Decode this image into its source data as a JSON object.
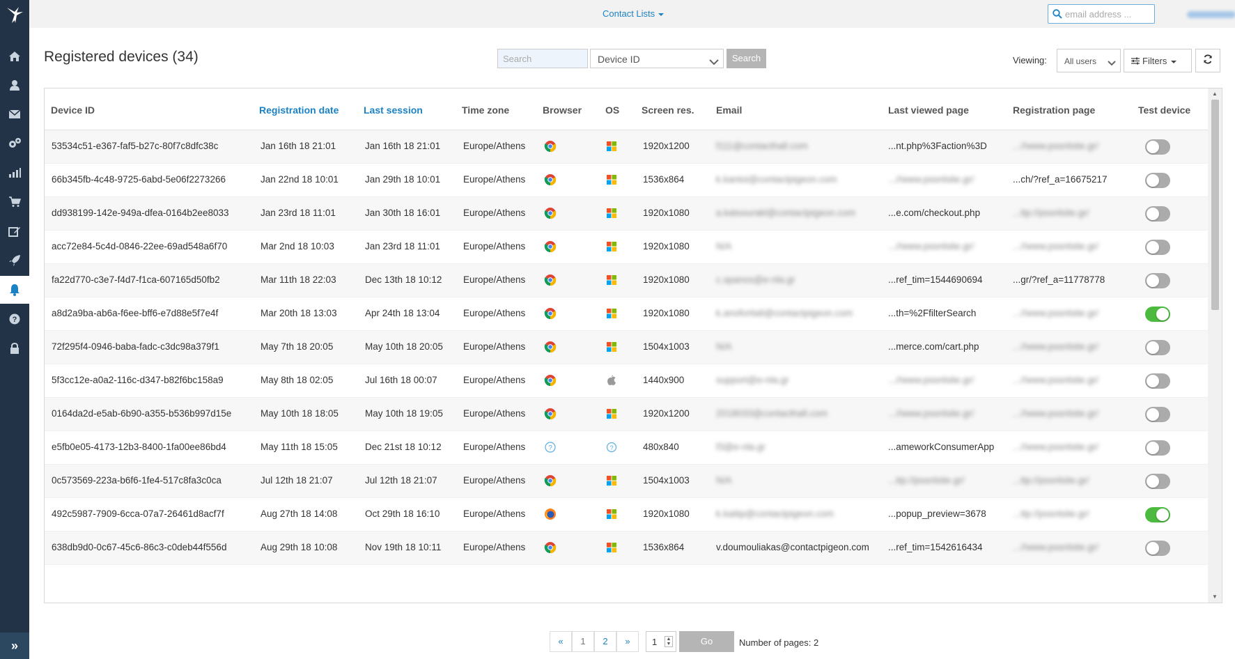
{
  "topbar": {
    "contact_lists": "Contact Lists",
    "email_placeholder": "email address ..."
  },
  "page": {
    "title": "Registered devices (34)"
  },
  "search": {
    "placeholder": "Search",
    "field": "Device ID",
    "button": "Search"
  },
  "viewing": {
    "label": "Viewing:",
    "value": "All users",
    "filters": "Filters"
  },
  "columns": [
    "Device ID",
    "Registration date",
    "Last session",
    "Time zone",
    "Browser",
    "OS",
    "Screen res.",
    "Email",
    "Last viewed page",
    "Registration page",
    "Test device"
  ],
  "rows": [
    {
      "id": "53534c51-e367-faf5-b27c-80f7c8dfc38c",
      "reg": "Jan 16th 18 21:01",
      "last": "Jan 16th 18 21:01",
      "tz": "Europe/Athens",
      "browser": "chrome",
      "os": "windows",
      "res": "1920x1200",
      "email": "f111@contacthall.com",
      "lastpage": "...nt.php%3Faction%3D",
      "lastpage_blur": false,
      "regpage": "...//www.pssnlsite.gr/",
      "regpage_blur": true,
      "test": false
    },
    {
      "id": "66b345fb-4c48-9725-6abd-5e06f2273266",
      "reg": "Jan 22nd 18 10:01",
      "last": "Jan 29th 18 10:01",
      "tz": "Europe/Athens",
      "browser": "chrome",
      "os": "windows",
      "res": "1536x864",
      "email": "k.kantoi@contactpigeon.com",
      "lastpage": "...//www.pssnlsite.gr/",
      "lastpage_blur": true,
      "regpage": "...ch/?ref_a=16675217",
      "regpage_blur": false,
      "test": false
    },
    {
      "id": "dd938199-142e-949a-dfea-0164b2ee8033",
      "reg": "Jan 23rd 18 11:01",
      "last": "Jan 30th 18 16:01",
      "tz": "Europe/Athens",
      "browser": "chrome",
      "os": "windows",
      "res": "1920x1080",
      "email": "a.katsourakl@contactpigeon.com",
      "lastpage": "...e.com/checkout.php",
      "lastpage_blur": false,
      "regpage": "...ttp://pssnlsite.gr/",
      "regpage_blur": true,
      "test": false
    },
    {
      "id": "acc72e84-5c4d-0846-22ee-69ad548a6f70",
      "reg": "Mar 2nd 18 10:03",
      "last": "Jan 23rd 18 11:01",
      "tz": "Europe/Athens",
      "browser": "chrome",
      "os": "windows",
      "res": "1920x1080",
      "email": "N/A",
      "lastpage": "...//www.pssnlsite.gr/",
      "lastpage_blur": true,
      "regpage": "...//www.pssnlsite.gr/",
      "regpage_blur": true,
      "test": false
    },
    {
      "id": "fa22d770-c3e7-f4d7-f1ca-607165d50fb2",
      "reg": "Mar 11th 18 22:03",
      "last": "Dec 13th 18 10:12",
      "tz": "Europe/Athens",
      "browser": "chrome",
      "os": "windows",
      "res": "1920x1080",
      "email": "c.spanos@e-nla.gr",
      "lastpage": "...ref_tim=1544690694",
      "lastpage_blur": false,
      "regpage": "...gr/?ref_a=11778778",
      "regpage_blur": false,
      "test": false
    },
    {
      "id": "a8d2a9ba-ab6a-f6ee-bff6-e7d88e5f7e4f",
      "reg": "Mar 20th 18 13:03",
      "last": "Apr 24th 18 13:04",
      "tz": "Europe/Athens",
      "browser": "chrome",
      "os": "windows",
      "res": "1920x1080",
      "email": "k.anoforitali@contactpigeon.com",
      "lastpage": "...th=%2FfilterSearch",
      "lastpage_blur": false,
      "regpage": "...//www.pssnlsite.gr/",
      "regpage_blur": true,
      "test": true
    },
    {
      "id": "72f295f4-0946-baba-fadc-c3dc98a379f1",
      "reg": "May 7th 18 20:05",
      "last": "May 10th 18 20:05",
      "tz": "Europe/Athens",
      "browser": "chrome",
      "os": "windows",
      "res": "1504x1003",
      "email": "N/A",
      "lastpage": "...merce.com/cart.php",
      "lastpage_blur": false,
      "regpage": "...//www.pssnlsite.gr/",
      "regpage_blur": true,
      "test": false
    },
    {
      "id": "5f3cc12e-a0a2-116c-d347-b82f6bc158a9",
      "reg": "May 8th 18 02:05",
      "last": "Jul 16th 18 00:07",
      "tz": "Europe/Athens",
      "browser": "chrome",
      "os": "apple",
      "res": "1440x900",
      "email": "support@e-nla.gr",
      "lastpage": "...//www.pssnlsite.gr/",
      "lastpage_blur": true,
      "regpage": "...//www.pssnlsite.gr/",
      "regpage_blur": true,
      "test": false
    },
    {
      "id": "0164da2d-e5ab-6b90-a355-b536b997d15e",
      "reg": "May 10th 18 18:05",
      "last": "May 10th 18 19:05",
      "tz": "Europe/Athens",
      "browser": "chrome",
      "os": "windows",
      "res": "1920x1200",
      "email": "2018033@contacthall.com",
      "lastpage": "...//www.pssnlsite.gr/",
      "lastpage_blur": true,
      "regpage": "...//www.pssnlsite.gr/",
      "regpage_blur": true,
      "test": false
    },
    {
      "id": "e5fb0e05-4173-12b3-8400-1fa00ee86bd4",
      "reg": "May 11th 18 15:05",
      "last": "Dec 21st 18 10:12",
      "tz": "Europe/Athens",
      "browser": "unknown",
      "os": "unknown",
      "res": "480x840",
      "email": "f3@e-nla.gr",
      "lastpage": "...ameworkConsumerApp",
      "lastpage_blur": false,
      "regpage": "...//www.pssnlsite.gr/",
      "regpage_blur": true,
      "test": false
    },
    {
      "id": "0c573569-223a-b6f6-1fe4-517c8fa3c0ca",
      "reg": "Jul 12th 18 21:07",
      "last": "Jul 12th 18 21:07",
      "tz": "Europe/Athens",
      "browser": "chrome",
      "os": "windows",
      "res": "1504x1003",
      "email": "N/A",
      "lastpage": "...ttp://pssnlsite.gr/",
      "lastpage_blur": true,
      "regpage": "...ttp://pssnlsite.gr/",
      "regpage_blur": true,
      "test": false
    },
    {
      "id": "492c5987-7909-6cca-07a7-26461d8acf7f",
      "reg": "Aug 27th 18 14:08",
      "last": "Oct 29th 18 16:10",
      "tz": "Europe/Athens",
      "browser": "firefox",
      "os": "windows",
      "res": "1920x1080",
      "email": "k.kaitip@contactpigeon.com",
      "lastpage": "...popup_preview=3678",
      "lastpage_blur": false,
      "regpage": "...ttp://pssnlsite.gr/",
      "regpage_blur": true,
      "test": true
    },
    {
      "id": "638db9d0-0c67-45c6-86c3-c0deb44f556d",
      "reg": "Aug 29th 18 10:08",
      "last": "Nov 19th 18 10:11",
      "tz": "Europe/Athens",
      "browser": "chrome",
      "os": "windows",
      "res": "1536x864",
      "email": "v.doumouliakas@contactpigeon.com",
      "email_clear": true,
      "lastpage": "...ref_tim=1542616434",
      "lastpage_blur": false,
      "regpage": "...//www.pssnlsite.gr/",
      "regpage_blur": true,
      "test": false
    }
  ],
  "pagination": {
    "prev": "«",
    "pages": [
      "1",
      "2"
    ],
    "next": "»",
    "input": "1",
    "go": "Go",
    "total_label": "Number of pages: 2"
  }
}
